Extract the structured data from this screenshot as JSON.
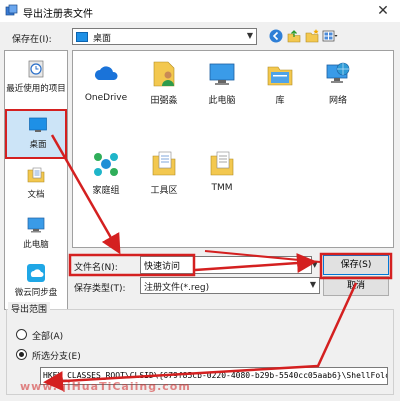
{
  "window": {
    "title": "导出注册表文件"
  },
  "header": {
    "save_in_label": "保存在(I):",
    "location": "桌面"
  },
  "toolbar": {
    "icons": [
      "back-icon",
      "up-folder-icon",
      "new-folder-icon",
      "view-menu-icon"
    ]
  },
  "places": [
    {
      "label": "最近使用的项目",
      "icon": "recent-icon",
      "selected": false
    },
    {
      "label": "桌面",
      "icon": "desktop-icon",
      "selected": true
    },
    {
      "label": "文档",
      "icon": "documents-icon",
      "selected": false
    },
    {
      "label": "此电脑",
      "icon": "computer-icon",
      "selected": false
    },
    {
      "label": "微云同步盘",
      "icon": "weiyun-icon",
      "selected": false
    }
  ],
  "files": [
    {
      "label": "OneDrive",
      "icon": "onedrive-icon"
    },
    {
      "label": "田弼淼",
      "icon": "user-folder-icon"
    },
    {
      "label": "此电脑",
      "icon": "computer-icon"
    },
    {
      "label": "库",
      "icon": "library-icon"
    },
    {
      "label": "网络",
      "icon": "network-icon"
    },
    {
      "label": "家庭组",
      "icon": "homegroup-icon"
    },
    {
      "label": "工具区",
      "icon": "folder-icon"
    },
    {
      "label": "TMM",
      "icon": "folder-icon"
    }
  ],
  "form": {
    "filename_label": "文件名(N):",
    "filename_value": "快速访问",
    "filetype_label": "保存类型(T):",
    "filetype_value": "注册文件(*.reg)",
    "save_button": "保存(S)",
    "cancel_button": "取消"
  },
  "export_range": {
    "title": "导出范围",
    "all_label": "全部(A)",
    "branch_label": "所选分支(E)",
    "selected_option": "branch",
    "branch_value": "HKEY_CLASSES_ROOT\\CLSID\\{679f85cb-0220-4080-b29b-5540cc05aab6}\\ShellFolc"
  },
  "watermark": "www.qiHuaTiCaiing.com",
  "colors": {
    "accent": "#0078d7",
    "annotation_red": "#d42020",
    "selection": "#cce4f7"
  }
}
